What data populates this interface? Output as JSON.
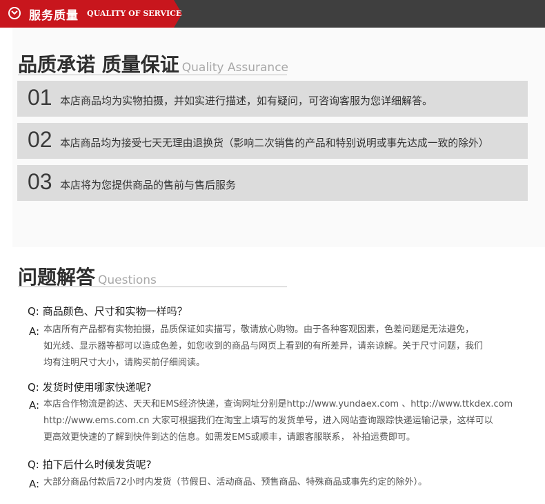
{
  "banner": {
    "title_cn": "服务质量",
    "title_en": "QUALITY OF SERVICE",
    "icon": "chevron-down-circle-icon"
  },
  "quality": {
    "title_cn": "品质承诺 质量保证",
    "title_en": "Quality Assurance",
    "items": [
      {
        "num": "01",
        "text": "本店商品均为实物拍摄，并如实进行描述，如有疑问，可咨询客服为您详细解答。"
      },
      {
        "num": "02",
        "text": "本店商品均为接受七天无理由退换货（影响二次销售的产品和特别说明或事先达成一致的除外）"
      },
      {
        "num": "03",
        "text": "本店将为您提供商品的售前与售后服务"
      }
    ]
  },
  "questions": {
    "title_cn": "问题解答",
    "title_en": "Questions",
    "faq": [
      {
        "q": "Q: 商品颜色、尺寸和实物一样吗？",
        "a_label": "A:",
        "a_lines": [
          "本店所有产品都有实物拍摄，品质保证如实描写，敬请放心购物。由于各种客观因素，色差问题是无法避免，",
          "如光线、显示器等都可以造成色差，如您收到的商品与网页上看到的有所差异，请亲谅解。关于尺寸问题，我们",
          "均有注明尺寸大小，请购买前仔细阅读。"
        ]
      },
      {
        "q": "Q: 发货时使用哪家快递呢?",
        "a_label": "A:",
        "a_lines": [
          "本店合作物流是韵达、天天和EMS经济快递，查询网址分别是http://www.yundaex.com 、http://www.ttkdex.com",
          "http://www.ems.com.cn   大家可根据我们在淘宝上填写的发货单号，进入网站查询跟踪快递运输记录，这样可以",
          "更高效更快速的了解到快件到达的信息。如需发EMS或顺丰，请跟客服联系， 补拍运费即可。"
        ]
      },
      {
        "q": "Q: 拍下后什么时候发货呢?",
        "a_label": "A:",
        "a_lines": [
          "大部分商品付款后72小时内发货（节假日、活动商品、预售商品、特殊商品或事先约定的除外）。"
        ]
      }
    ]
  }
}
